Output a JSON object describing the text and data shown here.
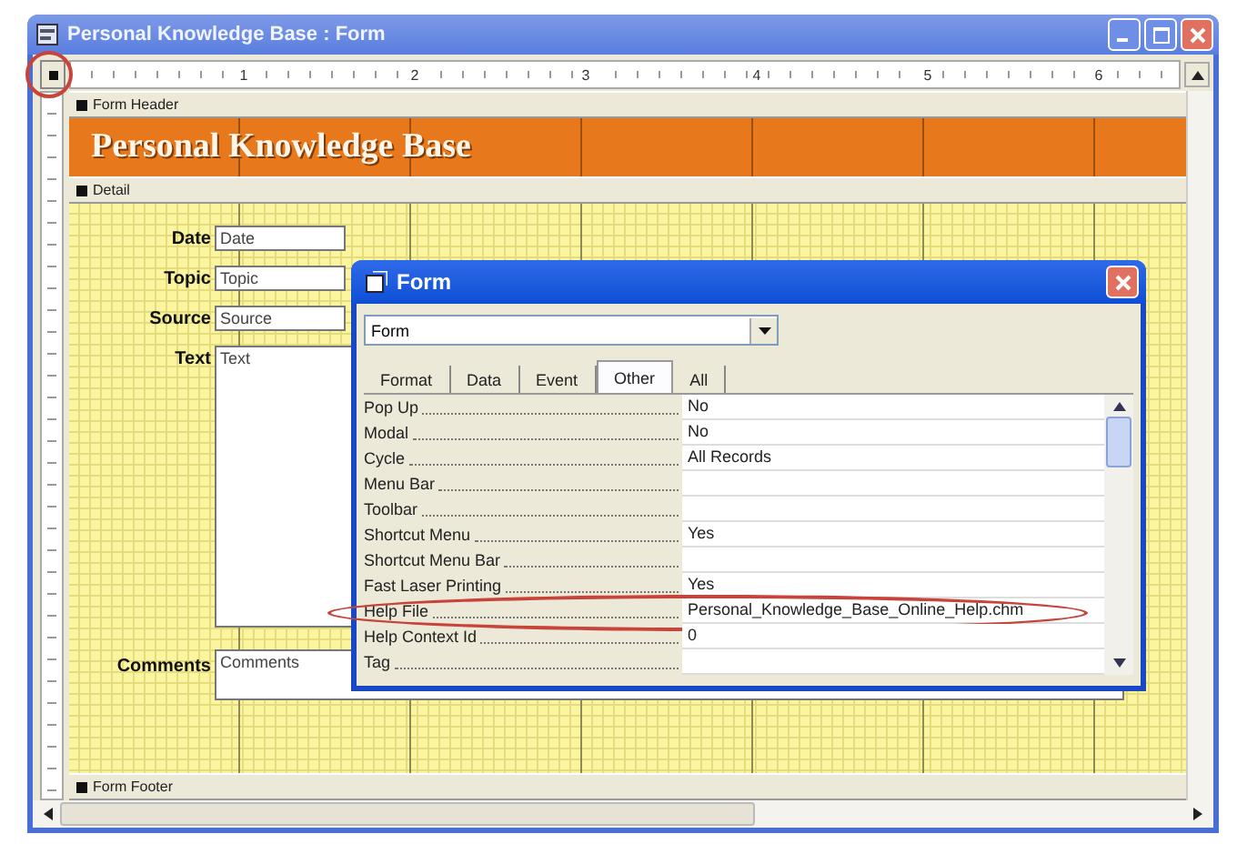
{
  "window": {
    "title": "Personal Knowledge Base : Form",
    "selector_circled": true
  },
  "ruler": {
    "marks": [
      "1",
      "2",
      "3",
      "4",
      "5",
      "6"
    ]
  },
  "sections": {
    "form_header": "Form Header",
    "detail": "Detail",
    "form_footer": "Form Footer"
  },
  "header_title": "Personal Knowledge Base",
  "fields": [
    {
      "label": "Date",
      "value": "Date",
      "kind": "short"
    },
    {
      "label": "Topic",
      "value": "Topic",
      "kind": "short"
    },
    {
      "label": "Source",
      "value": "Source",
      "kind": "short"
    },
    {
      "label": "Text",
      "value": "Text",
      "kind": "memo"
    },
    {
      "label": "Comments",
      "value": "Comments",
      "kind": "wide"
    }
  ],
  "property_sheet": {
    "title": "Form",
    "object": "Form",
    "tabs": [
      {
        "label": "Format",
        "selected": false
      },
      {
        "label": "Data",
        "selected": false
      },
      {
        "label": "Event",
        "selected": false
      },
      {
        "label": "Other",
        "selected": true
      },
      {
        "label": "All",
        "selected": false
      }
    ],
    "properties": [
      {
        "name": "Pop Up",
        "value": "No",
        "circled": false
      },
      {
        "name": "Modal",
        "value": "No",
        "circled": false
      },
      {
        "name": "Cycle",
        "value": "All Records",
        "circled": false
      },
      {
        "name": "Menu Bar",
        "circled": false
      },
      {
        "name": "Toolbar",
        "circled": false
      },
      {
        "name": "Shortcut Menu",
        "value": "Yes",
        "circled": false
      },
      {
        "name": "Shortcut Menu Bar",
        "circled": false
      },
      {
        "name": "Fast Laser Printing",
        "value": "Yes",
        "circled": false
      },
      {
        "name": "Help File",
        "value": "Personal_Knowledge_Base_Online_Help.chm",
        "circled": true
      },
      {
        "name": "Help Context Id",
        "value": "0",
        "circled": false
      },
      {
        "name": "Tag",
        "circled": false
      }
    ]
  }
}
